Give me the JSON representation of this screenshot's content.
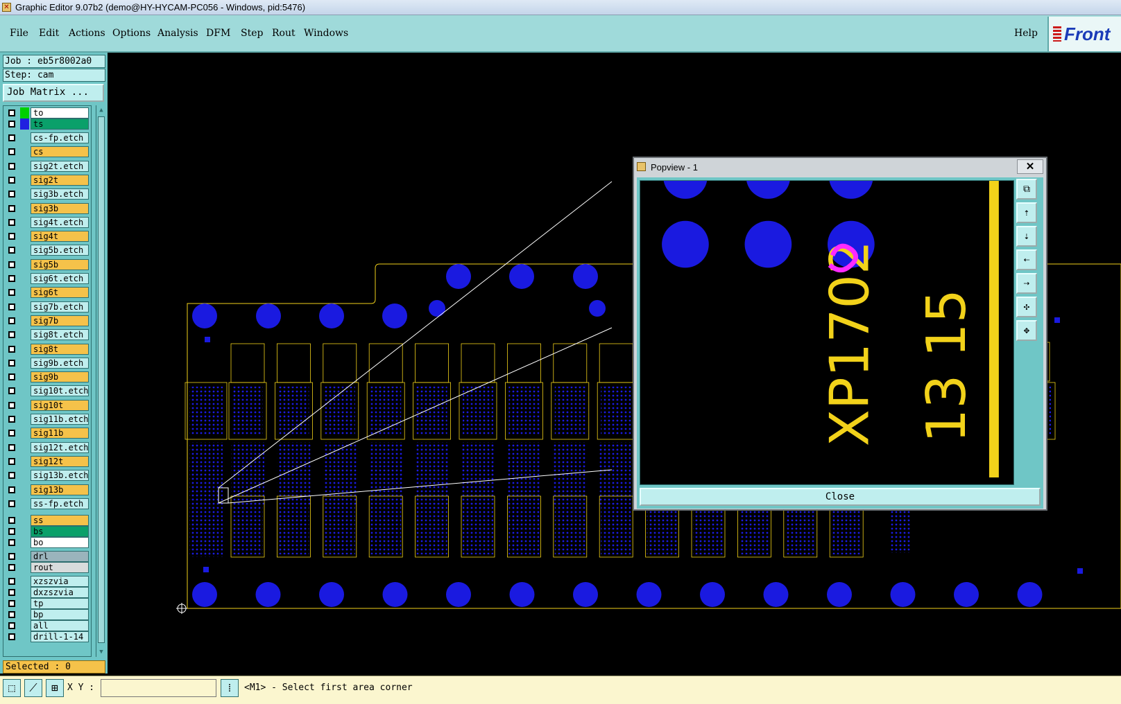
{
  "window": {
    "title": "Graphic Editor 9.07b2 (demo@HY-HYCAM-PC056 - Windows, pid:5476)"
  },
  "menu": {
    "items": [
      "File",
      "Edit",
      "Actions",
      "Options",
      "Analysis",
      "DFM",
      "Step",
      "Rout",
      "Windows"
    ],
    "help": "Help"
  },
  "logo": {
    "text": "Front"
  },
  "job": {
    "job_label": "Job : eb5r8002a0",
    "step_label": "Step: cam",
    "matrix_button": "Job Matrix ..."
  },
  "layers": [
    {
      "name": "to",
      "bg": "#ffffff",
      "swatch": "#00d000"
    },
    {
      "name": "ts",
      "bg": "#0aa06a",
      "swatch": "#2020e0"
    },
    {
      "name": "cs-fp.etch",
      "bg": "#bfeeee"
    },
    {
      "name": "cs",
      "bg": "#f5c24a"
    },
    {
      "name": "sig2t.etch",
      "bg": "#bfeeee"
    },
    {
      "name": "sig2t",
      "bg": "#f5c24a"
    },
    {
      "name": "sig3b.etch",
      "bg": "#bfeeee"
    },
    {
      "name": "sig3b",
      "bg": "#f5c24a"
    },
    {
      "name": "sig4t.etch",
      "bg": "#bfeeee"
    },
    {
      "name": "sig4t",
      "bg": "#f5c24a"
    },
    {
      "name": "sig5b.etch",
      "bg": "#bfeeee"
    },
    {
      "name": "sig5b",
      "bg": "#f5c24a"
    },
    {
      "name": "sig6t.etch",
      "bg": "#bfeeee"
    },
    {
      "name": "sig6t",
      "bg": "#f5c24a"
    },
    {
      "name": "sig7b.etch",
      "bg": "#bfeeee"
    },
    {
      "name": "sig7b",
      "bg": "#f5c24a"
    },
    {
      "name": "sig8t.etch",
      "bg": "#bfeeee"
    },
    {
      "name": "sig8t",
      "bg": "#f5c24a"
    },
    {
      "name": "sig9b.etch",
      "bg": "#bfeeee"
    },
    {
      "name": "sig9b",
      "bg": "#f5c24a"
    },
    {
      "name": "sig10t.etch",
      "bg": "#bfeeee"
    },
    {
      "name": "sig10t",
      "bg": "#f5c24a"
    },
    {
      "name": "sig11b.etch",
      "bg": "#bfeeee"
    },
    {
      "name": "sig11b",
      "bg": "#f5c24a"
    },
    {
      "name": "sig12t.etch",
      "bg": "#bfeeee"
    },
    {
      "name": "sig12t",
      "bg": "#f5c24a"
    },
    {
      "name": "sig13b.etch",
      "bg": "#bfeeee"
    },
    {
      "name": "sig13b",
      "bg": "#f5c24a"
    },
    {
      "name": "ss-fp.etch",
      "bg": "#bfeeee"
    },
    {
      "name": "ss",
      "bg": "#f5c24a"
    },
    {
      "name": "bs",
      "bg": "#0aa06a"
    },
    {
      "name": "bo",
      "bg": "#ffffff"
    },
    {
      "name": "drl",
      "bg": "#9ab4bc"
    },
    {
      "name": "rout",
      "bg": "#d8dcdc"
    },
    {
      "name": "xzszvia",
      "bg": "#bfeeee"
    },
    {
      "name": "dxzszvia",
      "bg": "#bfeeee"
    },
    {
      "name": "tp",
      "bg": "#bfeeee"
    },
    {
      "name": "bp",
      "bg": "#bfeeee"
    },
    {
      "name": "all",
      "bg": "#bfeeee"
    },
    {
      "name": "drill-1-14",
      "bg": "#bfeeee"
    }
  ],
  "status": {
    "selected": "Selected : 0"
  },
  "bottom": {
    "xy_label": "X Y :",
    "xy_value": "",
    "prompt": "<M1> - Select first area corner"
  },
  "popview": {
    "title": "Popview - 1",
    "close_x": "✕",
    "close_button": "Close",
    "zoom_text": {
      "line1": "XP1702",
      "line2": "13 15"
    }
  },
  "colors": {
    "pad": "#1a1ae0",
    "silk": "#f2d21a",
    "menu_bg": "#9fdada",
    "panel_bg": "#6fc6c6"
  }
}
